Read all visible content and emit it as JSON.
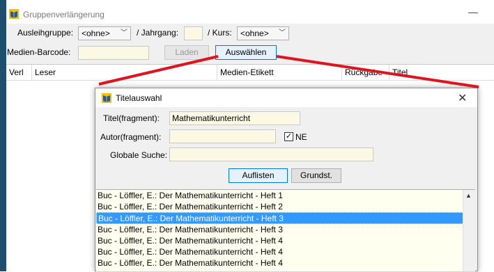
{
  "app": {
    "title": "Gruppenverlängerung",
    "minimize_glyph": "—"
  },
  "filters": {
    "ausleihgruppe_label": "Ausleihgruppe:",
    "ausleihgruppe_value": "<ohne>",
    "jahrgang_label": "/ Jahrgang:",
    "jahrgang_value": "",
    "kurs_label": "/ Kurs:",
    "kurs_value": "<ohne>",
    "barcode_label": "Medien-Barcode:",
    "barcode_value": "",
    "laden_label": "Laden",
    "auswaehlen_label": "Auswählen"
  },
  "grid": {
    "columns": [
      "Verl",
      "Leser",
      "Medien-Etikett",
      "Rückgabe",
      "Titel"
    ]
  },
  "dialog": {
    "title": "Titelauswahl",
    "close_glyph": "✕",
    "titel_label": "Titel(fragment):",
    "titel_value": "Mathematikunterricht",
    "autor_label": "Autor(fragment):",
    "autor_value": "",
    "ne_label": "NE",
    "ne_checked": "✓",
    "suche_label": "Globale Suche:",
    "suche_value": "",
    "auflisten_label": "Auflisten",
    "grundst_label": "Grundst.",
    "results": [
      "Buc - Löffler, E.: Der Mathematikunterricht - Heft 1",
      "Buc - Löffler, E.: Der Mathematikunterricht - Heft 2",
      "Buc - Löffler, E.: Der Mathematikunterricht - Heft 3",
      "Buc - Löffler, E.: Der Mathematikunterricht - Heft 3",
      "Buc - Löffler, E.: Der Mathematikunterricht - Heft 4",
      "Buc - Löffler, E.: Der Mathematikunterricht - Heft 4",
      "Buc - Löffler, E.: Der Mathematikunterricht - Heft 4"
    ],
    "selected_index": 2
  },
  "icons": {
    "app": "book-app-icon",
    "annotation": "red-annotation-line"
  },
  "colors": {
    "selection": "#3399ff",
    "input_bg": "#fbf8e4",
    "annotation": "#e0141e",
    "focus": "#0078d7"
  }
}
